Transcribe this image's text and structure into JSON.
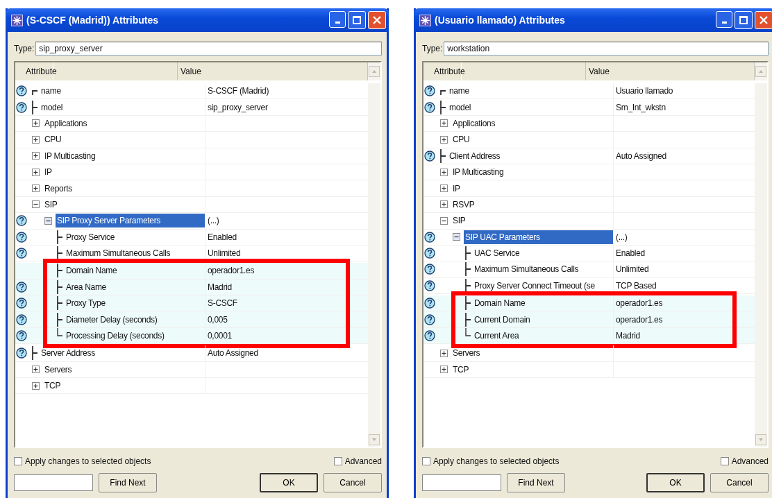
{
  "windows": [
    {
      "title": "(S-CSCF (Madrid)) Attributes",
      "type_label": "Type:",
      "type_value": "sip_proxy_server",
      "columns": [
        "Attribute",
        "Value"
      ],
      "rows": [
        {
          "label": "name",
          "value": "S-CSCF (Madrid)",
          "help": true,
          "kind": "first"
        },
        {
          "label": "model",
          "value": "sip_proxy_server",
          "help": true,
          "kind": "middle"
        },
        {
          "label": "Applications",
          "help": false,
          "kind": "group",
          "expanded": false
        },
        {
          "label": "CPU",
          "help": false,
          "kind": "group",
          "expanded": false
        },
        {
          "label": "IP Multicasting",
          "help": false,
          "kind": "group",
          "expanded": false
        },
        {
          "label": "IP",
          "help": false,
          "kind": "group",
          "expanded": false
        },
        {
          "label": "Reports",
          "help": false,
          "kind": "group",
          "expanded": false
        },
        {
          "label": "SIP",
          "help": false,
          "kind": "group",
          "expanded": true,
          "children": [
            {
              "label": "SIP Proxy Server Parameters",
              "value": "(...)",
              "help": true,
              "kind": "group",
              "expanded": true,
              "selected": true,
              "children": [
                {
                  "label": "Proxy Service",
                  "value": "Enabled",
                  "help": true,
                  "kind": "middle",
                  "highlighted": false
                },
                {
                  "label": "Maximum Simultaneous Calls",
                  "value": "Unlimited",
                  "help": true,
                  "kind": "middle",
                  "highlighted": false
                },
                {
                  "label": "Domain Name",
                  "value": "operador1.es",
                  "help": false,
                  "kind": "middle",
                  "highlighted": true
                },
                {
                  "label": "Area Name",
                  "value": "Madrid",
                  "help": true,
                  "kind": "middle",
                  "highlighted": true
                },
                {
                  "label": "Proxy Type",
                  "value": "S-CSCF",
                  "help": true,
                  "kind": "middle",
                  "highlighted": true
                },
                {
                  "label": "Diameter Delay (seconds)",
                  "value": "0,005",
                  "help": true,
                  "kind": "middle",
                  "highlighted": true
                },
                {
                  "label": "Processing Delay (seconds)",
                  "value": "0,0001",
                  "help": true,
                  "kind": "last",
                  "highlighted": true
                }
              ]
            }
          ]
        },
        {
          "label": "Server Address",
          "value": "Auto Assigned",
          "help": true,
          "kind": "middle"
        },
        {
          "label": "Servers",
          "help": false,
          "kind": "group",
          "expanded": false
        },
        {
          "label": "TCP",
          "help": false,
          "kind": "group",
          "expanded": false
        }
      ],
      "apply": {
        "label": "Apply changes to selected objects",
        "checked": false
      },
      "advanced": {
        "label": "Advanced",
        "checked": false
      },
      "find_button": "Find Next",
      "ok_button": "OK",
      "cancel_button": "Cancel"
    },
    {
      "title": "(Usuario llamado) Attributes",
      "type_label": "Type:",
      "type_value": "workstation",
      "columns": [
        "Attribute",
        "Value"
      ],
      "rows": [
        {
          "label": "name",
          "value": "Usuario llamado",
          "help": true,
          "kind": "first"
        },
        {
          "label": "model",
          "value": "Sm_Int_wkstn",
          "help": true,
          "kind": "middle"
        },
        {
          "label": "Applications",
          "help": false,
          "kind": "group",
          "expanded": false
        },
        {
          "label": "CPU",
          "help": false,
          "kind": "group",
          "expanded": false
        },
        {
          "label": "Client Address",
          "value": "Auto Assigned",
          "help": true,
          "kind": "middle"
        },
        {
          "label": "IP Multicasting",
          "help": false,
          "kind": "group",
          "expanded": false
        },
        {
          "label": "IP",
          "help": false,
          "kind": "group",
          "expanded": false
        },
        {
          "label": "RSVP",
          "help": false,
          "kind": "group",
          "expanded": false
        },
        {
          "label": "SIP",
          "help": false,
          "kind": "group",
          "expanded": true,
          "children": [
            {
              "label": "SIP UAC Parameters",
              "value": "(...)",
              "help": true,
              "kind": "group",
              "expanded": true,
              "selected": true,
              "children": [
                {
                  "label": "UAC Service",
                  "value": "Enabled",
                  "help": true,
                  "kind": "middle",
                  "highlighted": false
                },
                {
                  "label": "Maximum Simultaneous Calls",
                  "value": "Unlimited",
                  "help": true,
                  "kind": "middle",
                  "highlighted": false
                },
                {
                  "label": "Proxy Server Connect Timeout (se",
                  "value": "TCP Based",
                  "help": true,
                  "kind": "middle",
                  "highlighted": false
                },
                {
                  "label": "Domain Name",
                  "value": "operador1.es",
                  "help": true,
                  "kind": "middle",
                  "highlighted": true
                },
                {
                  "label": "Current Domain",
                  "value": "operador1.es",
                  "help": true,
                  "kind": "middle",
                  "highlighted": true
                },
                {
                  "label": "Current Area",
                  "value": "Madrid",
                  "help": true,
                  "kind": "last",
                  "highlighted": true
                }
              ]
            }
          ]
        },
        {
          "label": "Servers",
          "help": false,
          "kind": "group",
          "expanded": false
        },
        {
          "label": "TCP",
          "help": false,
          "kind": "group",
          "expanded": false
        }
      ],
      "apply": {
        "label": "Apply changes to selected objects",
        "checked": false
      },
      "advanced": {
        "label": "Advanced",
        "checked": false
      },
      "find_button": "Find Next",
      "ok_button": "OK",
      "cancel_button": "Cancel"
    }
  ]
}
